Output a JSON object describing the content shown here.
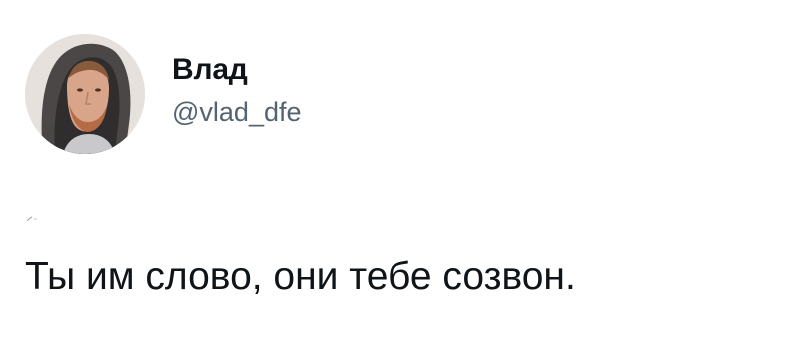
{
  "author": {
    "display_name": "Влад",
    "handle": "@vlad_dfe",
    "avatar_icon": "profile-photo-avatar"
  },
  "tweet": {
    "text": "Ты им слово, они тебе созвон."
  },
  "colors": {
    "background": "#ffffff",
    "primary_text": "#0f1419",
    "secondary_text": "#536471"
  }
}
